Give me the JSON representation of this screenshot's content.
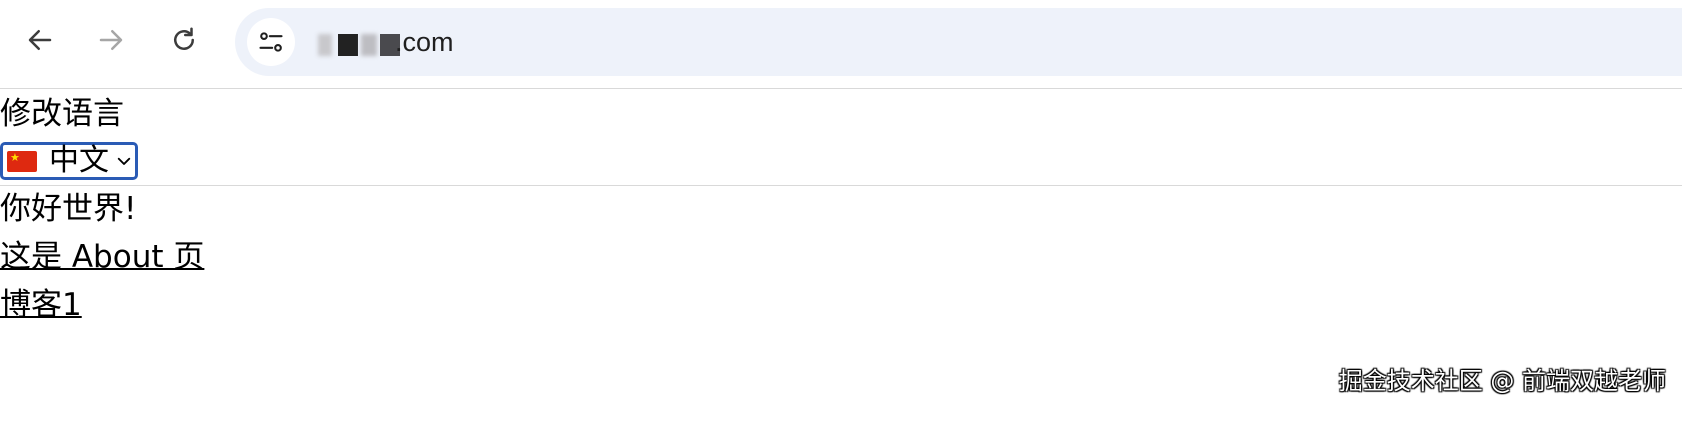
{
  "browser": {
    "back_icon": "arrow-left-icon",
    "forward_icon": "arrow-right-icon",
    "reload_icon": "reload-icon",
    "site_info_icon": "tune-icon",
    "url_suffix": ".com"
  },
  "page": {
    "change_language_label": "修改语言",
    "language_select": {
      "flag_icon": "china-flag-icon",
      "selected": "中文"
    },
    "greeting": "你好世界!",
    "links": [
      "这是 About 页",
      "博客1"
    ]
  },
  "watermark": "掘金技术社区 @ 前端双越老师"
}
